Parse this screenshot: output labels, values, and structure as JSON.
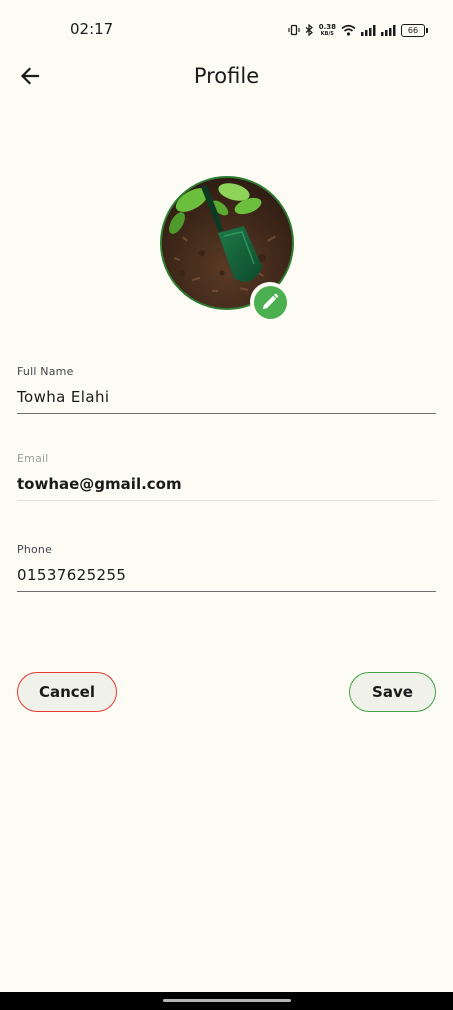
{
  "status_bar": {
    "time": "02:17",
    "net_speed_value": "0.38",
    "net_speed_unit": "KB/S",
    "battery": "66",
    "icons": [
      "vibrate-icon",
      "bluetooth-icon",
      "wifi-icon",
      "signal-icon",
      "signal-icon",
      "battery-icon"
    ]
  },
  "app_bar": {
    "title": "Profile",
    "back_icon": "arrow-back-icon"
  },
  "avatar": {
    "image": "garden-trowel-in-soil",
    "edit_icon": "pencil-icon",
    "accent_color": "#4caf50",
    "ring_color": "#2e7d32"
  },
  "form": {
    "full_name": {
      "label": "Full Name",
      "value": "Towha Elahi"
    },
    "email": {
      "label": "Email",
      "value": "towhae@gmail.com"
    },
    "phone": {
      "label": "Phone",
      "value": "01537625255"
    }
  },
  "actions": {
    "cancel_label": "Cancel",
    "save_label": "Save",
    "cancel_border_color": "#e53935",
    "save_border_color": "#43a047"
  },
  "colors": {
    "background": "#fcfcf5"
  }
}
